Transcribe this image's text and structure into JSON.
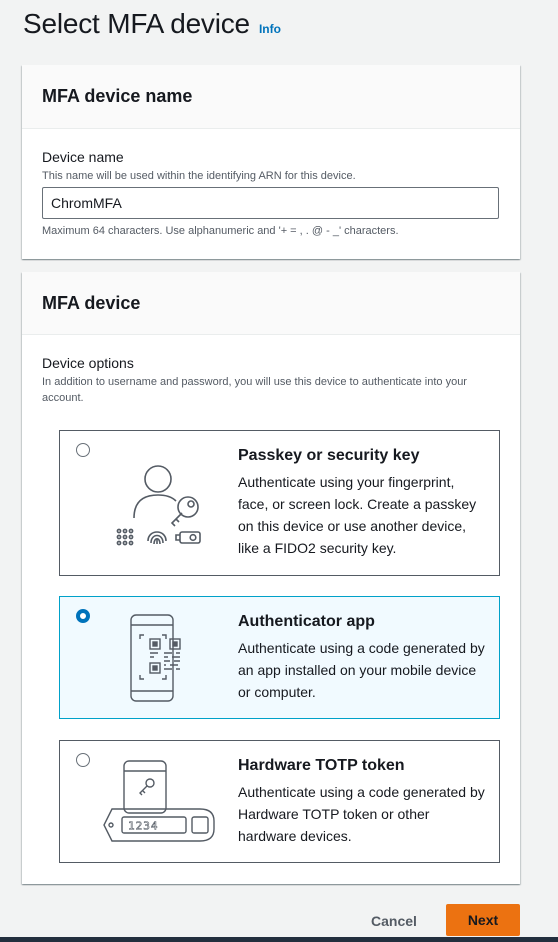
{
  "page": {
    "title": "Select MFA device",
    "info_link": "Info"
  },
  "name_section": {
    "heading": "MFA device name",
    "field_label": "Device name",
    "field_description": "This name will be used within the identifying ARN for this device.",
    "field_value": "ChromMFA",
    "constraint": "Maximum 64 characters. Use alphanumeric and '+ = , . @ - _' characters."
  },
  "device_section": {
    "heading": "MFA device",
    "options_label": "Device options",
    "options_description": "In addition to username and password, you will use this device to authenticate into your account.",
    "options": [
      {
        "title": "Passkey or security key",
        "description": "Authenticate using your fingerprint, face, or screen lock. Create a passkey on this device or use another device, like a FIDO2 security key.",
        "selected": false,
        "icon": "passkey-icon"
      },
      {
        "title": "Authenticator app",
        "description": "Authenticate using a code generated by an app installed on your mobile device or computer.",
        "selected": true,
        "icon": "authenticator-phone-icon"
      },
      {
        "title": "Hardware TOTP token",
        "description": "Authenticate using a code generated by Hardware TOTP token or other hardware devices.",
        "selected": false,
        "icon": "hardware-token-icon",
        "token_display": "1234"
      }
    ]
  },
  "footer": {
    "cancel_label": "Cancel",
    "next_label": "Next"
  },
  "colors": {
    "primary_button": "#ec7211",
    "link": "#0073bb",
    "selected_tile_bg": "#f1faff",
    "selected_tile_border": "#00a1c9"
  }
}
